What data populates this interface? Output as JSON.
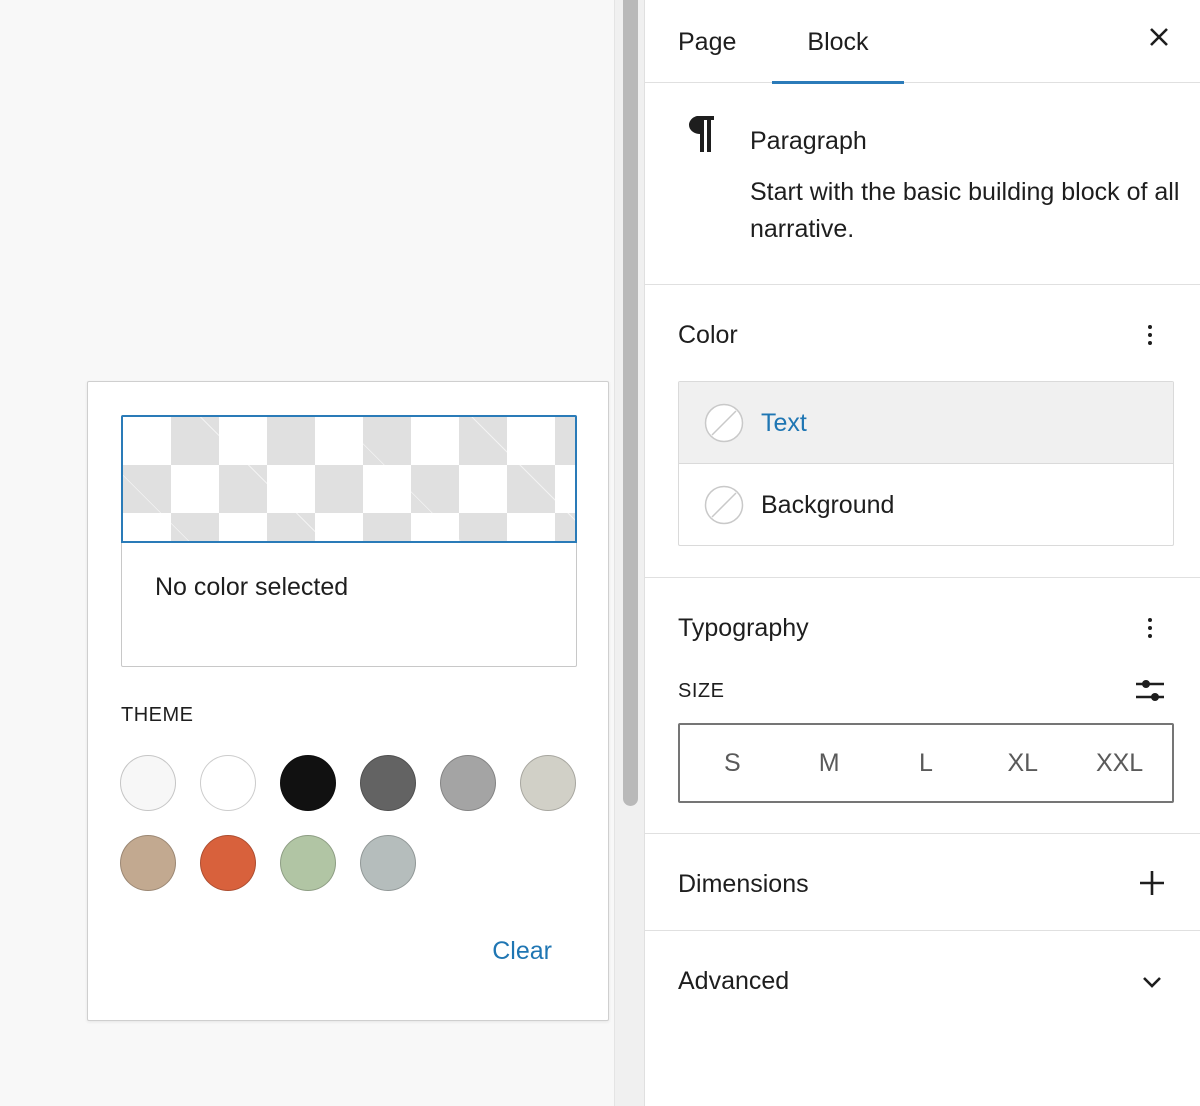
{
  "colors": {
    "accent": "#2271b1",
    "canvas_bg": "#f8f8f8",
    "border": "#e0e0e0"
  },
  "popover": {
    "preview_text": "No color selected",
    "theme_label": "THEME",
    "clear_label": "Clear",
    "theme_colors": [
      {
        "icon": "swatch",
        "hex": "#f7f7f7"
      },
      {
        "icon": "swatch",
        "hex": "#ffffff"
      },
      {
        "icon": "swatch",
        "hex": "#111111"
      },
      {
        "icon": "swatch",
        "hex": "#636363"
      },
      {
        "icon": "swatch",
        "hex": "#a4a4a4"
      },
      {
        "icon": "swatch",
        "hex": "#d1d0c7"
      },
      {
        "icon": "swatch",
        "hex": "#c2a990"
      },
      {
        "icon": "swatch",
        "hex": "#d8613c"
      },
      {
        "icon": "swatch",
        "hex": "#b1c5a4"
      },
      {
        "icon": "swatch",
        "hex": "#b5bdbc"
      }
    ]
  },
  "sidebar": {
    "tabs": [
      {
        "label": "Page",
        "active": false
      },
      {
        "label": "Block",
        "active": true
      }
    ],
    "close_icon": "close-icon",
    "block": {
      "icon": "pilcrow-icon",
      "title": "Paragraph",
      "description": "Start with the basic building block of all narrative."
    },
    "color_panel": {
      "title": "Color",
      "items": [
        {
          "label": "Text",
          "active": true
        },
        {
          "label": "Background",
          "active": false
        }
      ]
    },
    "typography_panel": {
      "title": "Typography",
      "size_label": "SIZE",
      "sizes": [
        "S",
        "M",
        "L",
        "XL",
        "XXL"
      ]
    },
    "dimensions_panel": {
      "title": "Dimensions"
    },
    "advanced_panel": {
      "title": "Advanced"
    }
  }
}
